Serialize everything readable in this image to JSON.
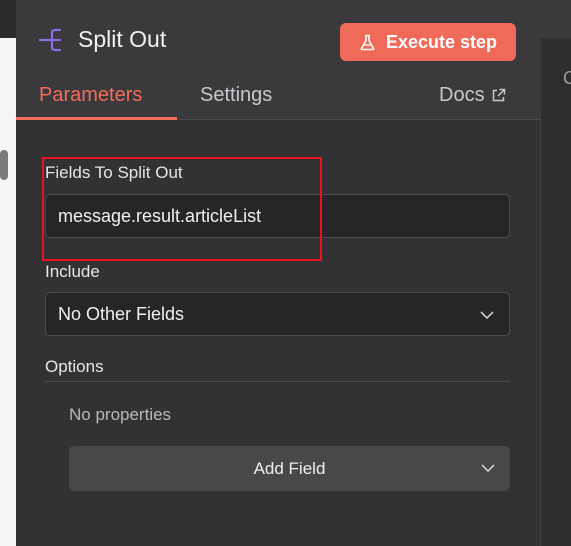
{
  "node": {
    "title": "Split Out",
    "icon": "split-out-icon",
    "execute_label": "Execute step"
  },
  "tabs": [
    {
      "label": "Parameters",
      "active": true
    },
    {
      "label": "Settings",
      "active": false
    },
    {
      "label": "Docs",
      "active": false
    }
  ],
  "params": {
    "fields_label": "Fields To Split Out",
    "fields_value": "message.result.articleList",
    "include_label": "Include",
    "include_value": "No Other Fields",
    "options_label": "Options",
    "no_properties": "No properties",
    "add_field_label": "Add Field"
  },
  "colors": {
    "accent": "#f06a5a",
    "highlight": "#e5141f"
  }
}
